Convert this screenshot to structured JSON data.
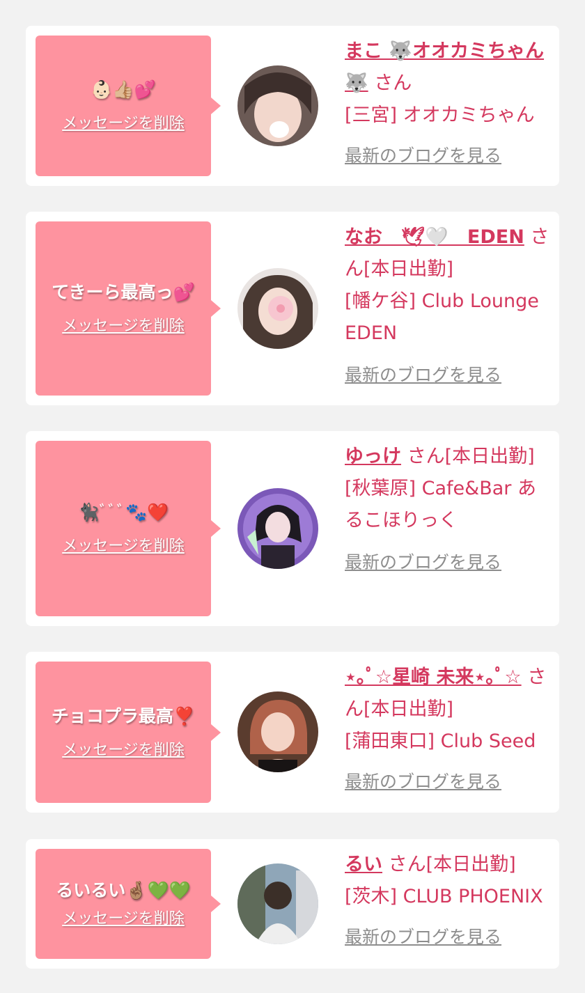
{
  "delete_label": "メッセージを削除",
  "blog_label": "最新のブログを見る",
  "colors": {
    "page_bg": "#f2f2f2",
    "card_bg": "#ffffff",
    "bubble_bg": "#fe939f",
    "accent_text": "#d4385e",
    "link_gray": "#8d8d8d"
  },
  "cards": [
    {
      "message": "",
      "message_emoji": "👶🏻👍🏼💕",
      "cast_name": "まこ 🐺オオカミちゃん🐺",
      "honorific": "さん",
      "shop": "[三宮] オオカミちゃん"
    },
    {
      "message": "てきーら最高っ",
      "message_emoji": "💕",
      "cast_name": "なお　🕊🤍　EDEN",
      "honorific": "さん[本日出勤]",
      "shop": "[幡ケ谷] Club Lounge EDEN"
    },
    {
      "message": "",
      "message_emoji": "🐈‍⬛ﾞﾞﾞ🐾❤️",
      "cast_name": "ゆっけ",
      "honorific": "さん[本日出勤]",
      "shop": "[秋葉原] Cafe&Bar あるこほりっく"
    },
    {
      "message": "チョコプラ最高",
      "message_emoji": "❣️",
      "cast_name": "⋆｡ﾟ☆星崎 未来⋆｡ﾟ☆",
      "honorific": "さん[本日出勤]",
      "shop": "[蒲田東口] Club Seed"
    },
    {
      "message": "るいるい",
      "message_emoji": "🤞🏽💚💚",
      "cast_name": "るい",
      "honorific": "さん[本日出勤]",
      "shop": "[茨木] CLUB PHOENIX"
    }
  ]
}
